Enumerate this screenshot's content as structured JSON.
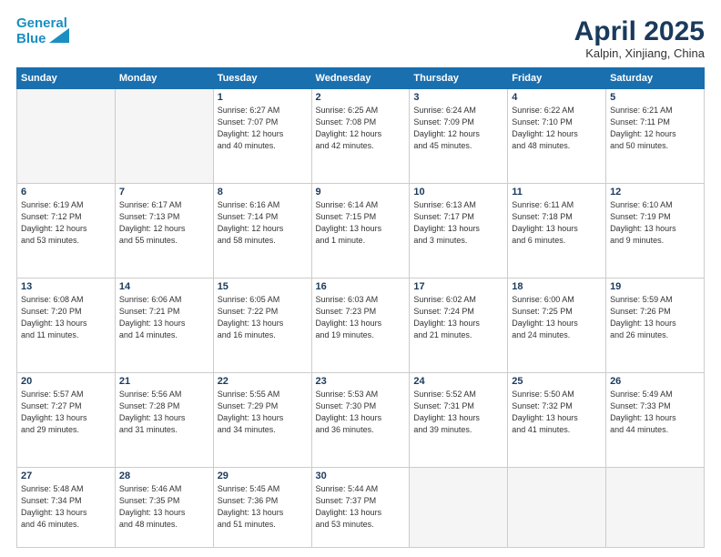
{
  "header": {
    "logo_line1": "General",
    "logo_line2": "Blue",
    "month": "April 2025",
    "location": "Kalpin, Xinjiang, China"
  },
  "weekdays": [
    "Sunday",
    "Monday",
    "Tuesday",
    "Wednesday",
    "Thursday",
    "Friday",
    "Saturday"
  ],
  "weeks": [
    [
      {
        "day": "",
        "info": ""
      },
      {
        "day": "",
        "info": ""
      },
      {
        "day": "1",
        "info": "Sunrise: 6:27 AM\nSunset: 7:07 PM\nDaylight: 12 hours\nand 40 minutes."
      },
      {
        "day": "2",
        "info": "Sunrise: 6:25 AM\nSunset: 7:08 PM\nDaylight: 12 hours\nand 42 minutes."
      },
      {
        "day": "3",
        "info": "Sunrise: 6:24 AM\nSunset: 7:09 PM\nDaylight: 12 hours\nand 45 minutes."
      },
      {
        "day": "4",
        "info": "Sunrise: 6:22 AM\nSunset: 7:10 PM\nDaylight: 12 hours\nand 48 minutes."
      },
      {
        "day": "5",
        "info": "Sunrise: 6:21 AM\nSunset: 7:11 PM\nDaylight: 12 hours\nand 50 minutes."
      }
    ],
    [
      {
        "day": "6",
        "info": "Sunrise: 6:19 AM\nSunset: 7:12 PM\nDaylight: 12 hours\nand 53 minutes."
      },
      {
        "day": "7",
        "info": "Sunrise: 6:17 AM\nSunset: 7:13 PM\nDaylight: 12 hours\nand 55 minutes."
      },
      {
        "day": "8",
        "info": "Sunrise: 6:16 AM\nSunset: 7:14 PM\nDaylight: 12 hours\nand 58 minutes."
      },
      {
        "day": "9",
        "info": "Sunrise: 6:14 AM\nSunset: 7:15 PM\nDaylight: 13 hours\nand 1 minute."
      },
      {
        "day": "10",
        "info": "Sunrise: 6:13 AM\nSunset: 7:17 PM\nDaylight: 13 hours\nand 3 minutes."
      },
      {
        "day": "11",
        "info": "Sunrise: 6:11 AM\nSunset: 7:18 PM\nDaylight: 13 hours\nand 6 minutes."
      },
      {
        "day": "12",
        "info": "Sunrise: 6:10 AM\nSunset: 7:19 PM\nDaylight: 13 hours\nand 9 minutes."
      }
    ],
    [
      {
        "day": "13",
        "info": "Sunrise: 6:08 AM\nSunset: 7:20 PM\nDaylight: 13 hours\nand 11 minutes."
      },
      {
        "day": "14",
        "info": "Sunrise: 6:06 AM\nSunset: 7:21 PM\nDaylight: 13 hours\nand 14 minutes."
      },
      {
        "day": "15",
        "info": "Sunrise: 6:05 AM\nSunset: 7:22 PM\nDaylight: 13 hours\nand 16 minutes."
      },
      {
        "day": "16",
        "info": "Sunrise: 6:03 AM\nSunset: 7:23 PM\nDaylight: 13 hours\nand 19 minutes."
      },
      {
        "day": "17",
        "info": "Sunrise: 6:02 AM\nSunset: 7:24 PM\nDaylight: 13 hours\nand 21 minutes."
      },
      {
        "day": "18",
        "info": "Sunrise: 6:00 AM\nSunset: 7:25 PM\nDaylight: 13 hours\nand 24 minutes."
      },
      {
        "day": "19",
        "info": "Sunrise: 5:59 AM\nSunset: 7:26 PM\nDaylight: 13 hours\nand 26 minutes."
      }
    ],
    [
      {
        "day": "20",
        "info": "Sunrise: 5:57 AM\nSunset: 7:27 PM\nDaylight: 13 hours\nand 29 minutes."
      },
      {
        "day": "21",
        "info": "Sunrise: 5:56 AM\nSunset: 7:28 PM\nDaylight: 13 hours\nand 31 minutes."
      },
      {
        "day": "22",
        "info": "Sunrise: 5:55 AM\nSunset: 7:29 PM\nDaylight: 13 hours\nand 34 minutes."
      },
      {
        "day": "23",
        "info": "Sunrise: 5:53 AM\nSunset: 7:30 PM\nDaylight: 13 hours\nand 36 minutes."
      },
      {
        "day": "24",
        "info": "Sunrise: 5:52 AM\nSunset: 7:31 PM\nDaylight: 13 hours\nand 39 minutes."
      },
      {
        "day": "25",
        "info": "Sunrise: 5:50 AM\nSunset: 7:32 PM\nDaylight: 13 hours\nand 41 minutes."
      },
      {
        "day": "26",
        "info": "Sunrise: 5:49 AM\nSunset: 7:33 PM\nDaylight: 13 hours\nand 44 minutes."
      }
    ],
    [
      {
        "day": "27",
        "info": "Sunrise: 5:48 AM\nSunset: 7:34 PM\nDaylight: 13 hours\nand 46 minutes."
      },
      {
        "day": "28",
        "info": "Sunrise: 5:46 AM\nSunset: 7:35 PM\nDaylight: 13 hours\nand 48 minutes."
      },
      {
        "day": "29",
        "info": "Sunrise: 5:45 AM\nSunset: 7:36 PM\nDaylight: 13 hours\nand 51 minutes."
      },
      {
        "day": "30",
        "info": "Sunrise: 5:44 AM\nSunset: 7:37 PM\nDaylight: 13 hours\nand 53 minutes."
      },
      {
        "day": "",
        "info": ""
      },
      {
        "day": "",
        "info": ""
      },
      {
        "day": "",
        "info": ""
      }
    ]
  ]
}
